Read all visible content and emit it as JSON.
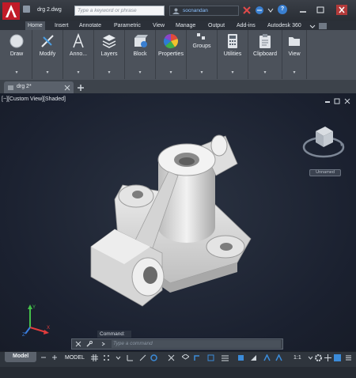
{
  "title_bar": {
    "document_title": "drg 2.dwg",
    "search_placeholder": "Type a keyword or phrase",
    "user_name": "socnandan",
    "help_symbol": "?"
  },
  "ribbon_tabs": [
    "Home",
    "Insert",
    "Annotate",
    "Parametric",
    "View",
    "Manage",
    "Output",
    "Add-ins",
    "Autodesk 360"
  ],
  "ribbon_panels": [
    {
      "label": "Draw",
      "icon": "draw-icon"
    },
    {
      "label": "Modify",
      "icon": "modify-icon"
    },
    {
      "label": "Anno...",
      "icon": "annotation-icon"
    },
    {
      "label": "Layers",
      "icon": "layers-icon"
    },
    {
      "label": "Block",
      "icon": "block-icon"
    },
    {
      "label": "Properties",
      "icon": "properties-icon"
    },
    {
      "label": "Groups",
      "icon": "groups-icon"
    },
    {
      "label": "Utilities",
      "icon": "calculator-icon"
    },
    {
      "label": "Clipboard",
      "icon": "clipboard-icon"
    },
    {
      "label": "View",
      "icon": "view-icon"
    }
  ],
  "file_tab": {
    "label": "drg 2*"
  },
  "viewport": {
    "label": "[−][Custom View][Shaded]",
    "viewcube_label": "Unnamed"
  },
  "command": {
    "history_label": "Command:",
    "input_placeholder": "Type a command"
  },
  "status_bar": {
    "model_tab": "Model",
    "model_button": "MODEL",
    "scale": "1:1"
  },
  "colors": {
    "ribbon_bg": "#4c525b",
    "viewport_bg": "#1f2533",
    "part_shade": "#d9d9d9",
    "accent_blue": "#3b8bd9",
    "logo_red": "#d2202e"
  }
}
